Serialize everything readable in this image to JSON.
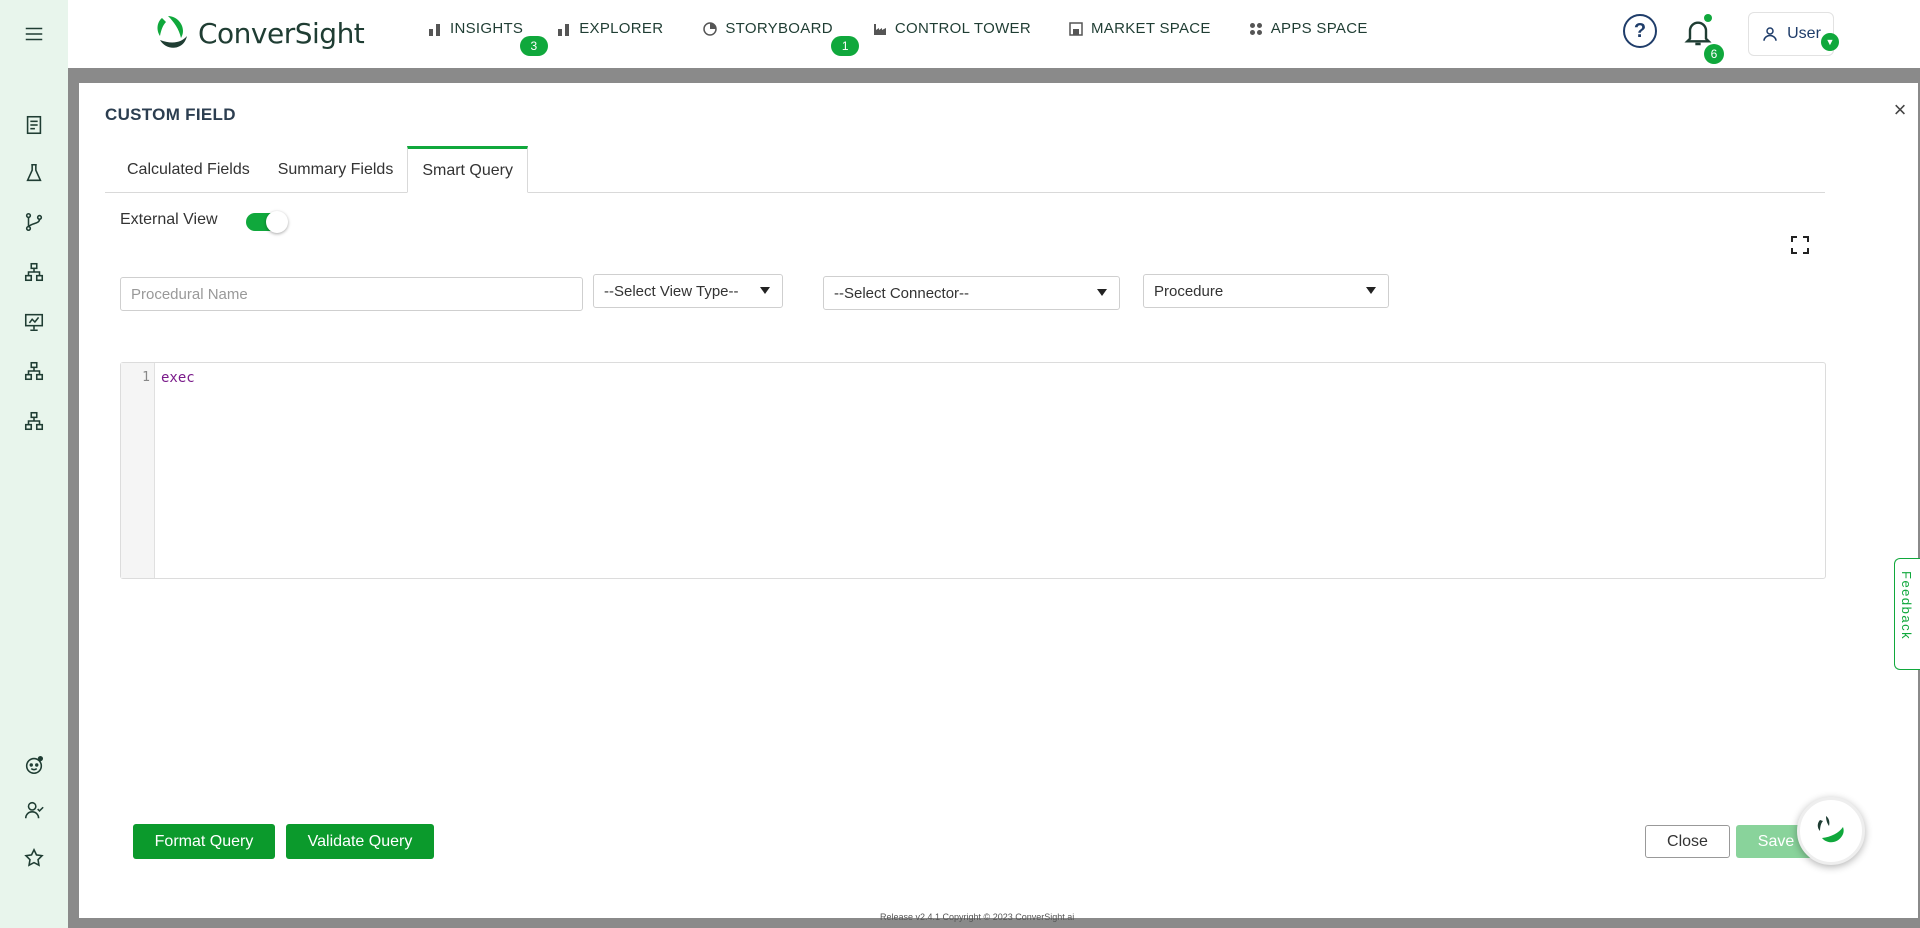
{
  "brand": {
    "name": "ConverSight",
    "accent": "#10a83c"
  },
  "nav": {
    "items": [
      {
        "label": "INSIGHTS",
        "icon": "bar-chart-icon",
        "badge": "3"
      },
      {
        "label": "EXPLORER",
        "icon": "bar-chart-icon",
        "badge": ""
      },
      {
        "label": "STORYBOARD",
        "icon": "pie-icon",
        "badge": "1"
      },
      {
        "label": "CONTROL TOWER",
        "icon": "factory-icon",
        "badge": ""
      },
      {
        "label": "MARKET SPACE",
        "icon": "store-icon",
        "badge": ""
      },
      {
        "label": "APPS SPACE",
        "icon": "apps-icon",
        "badge": ""
      }
    ]
  },
  "header": {
    "notifications_count": "6",
    "user_label": "User"
  },
  "modal": {
    "title": "CUSTOM FIELD",
    "tabs": [
      "Calculated Fields",
      "Summary Fields",
      "Smart Query"
    ],
    "active_tab": "Smart Query",
    "external_view_label": "External View",
    "external_view_on": true,
    "procedural_name_placeholder": "Procedural Name",
    "view_type_select": "--Select View Type--",
    "connector_select": "--Select Connector--",
    "procedure_select": "Procedure",
    "editor": {
      "line_number": "1",
      "code": "exec"
    },
    "buttons": {
      "format_query": "Format Query",
      "validate_query": "Validate Query",
      "close": "Close",
      "save": "Save"
    }
  },
  "feedback_label": "Feedback",
  "footer_text": "Release v2.4.1 Copyright © 2023 ConverSight.ai"
}
